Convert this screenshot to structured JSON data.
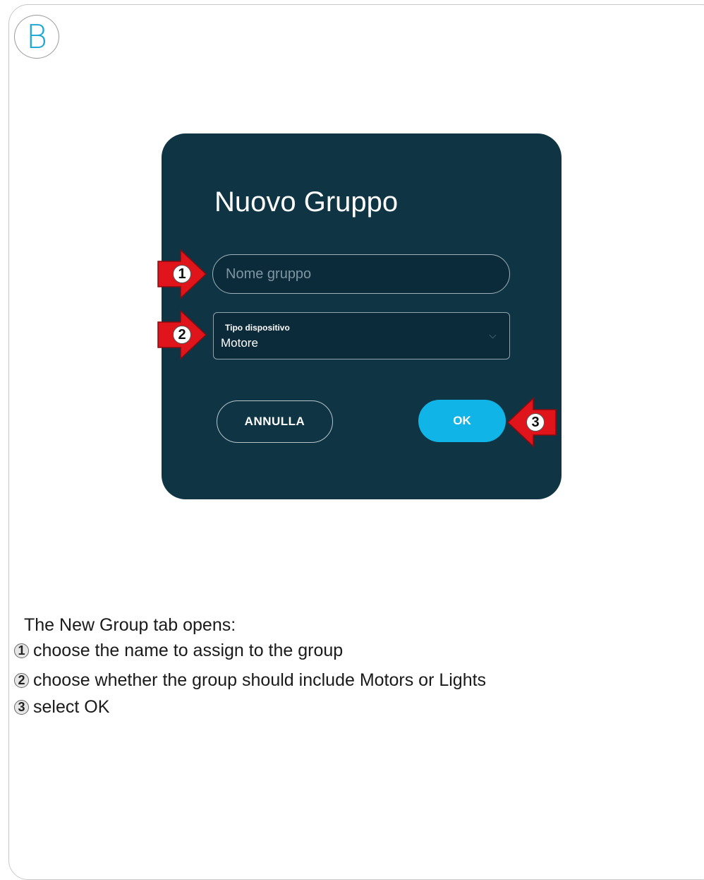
{
  "section_badge": "B",
  "dialog": {
    "title": "Nuovo Gruppo",
    "name_input": {
      "placeholder": "Nome gruppo",
      "value": ""
    },
    "device_type": {
      "label": "Tipo dispositivo",
      "value": "Motore"
    },
    "cancel_label": "ANNULLA",
    "ok_label": "OK"
  },
  "callouts": [
    "1",
    "2",
    "3"
  ],
  "instructions": {
    "intro": "The New Group tab opens:",
    "steps": [
      {
        "num": "1",
        "text": "choose the name to assign to the group"
      },
      {
        "num": "2",
        "text": "choose whether the group should include Motors or Lights"
      },
      {
        "num": "3",
        "text": "select OK"
      }
    ]
  },
  "colors": {
    "dialog_bg": "#0f3545",
    "accent": "#10b4e6",
    "callout_arrow": "#e0141b"
  },
  "icons": {
    "callout_arrow": "red-arrow-icon",
    "select_chevron": "chevron-down-icon"
  }
}
